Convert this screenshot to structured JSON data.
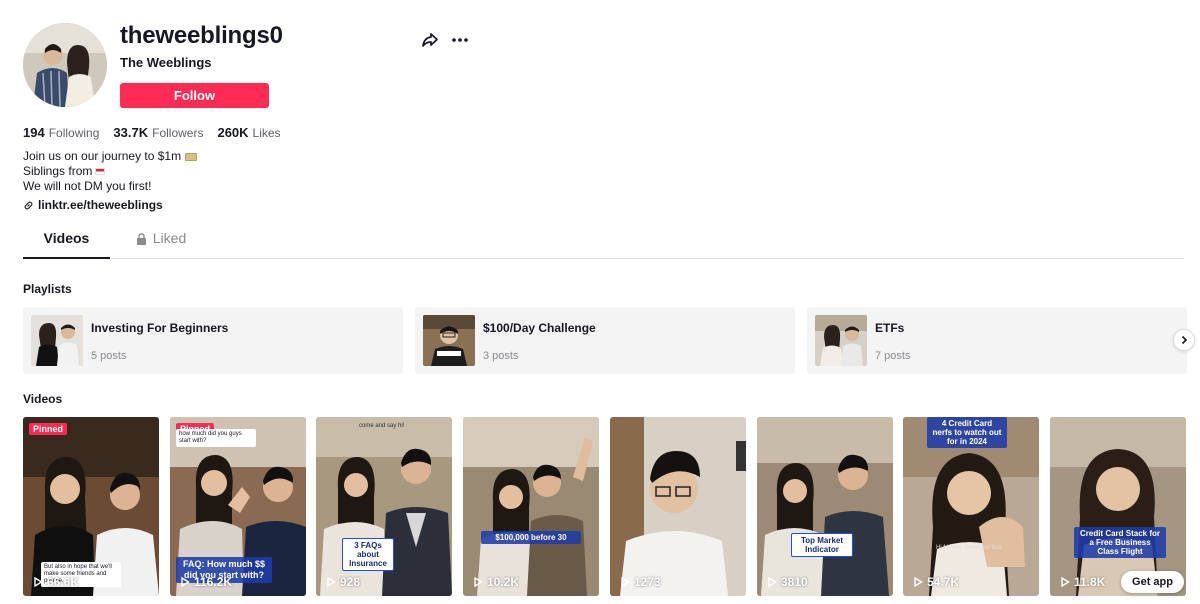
{
  "profile": {
    "username": "theweeblings0",
    "nickname": "The Weeblings",
    "follow_label": "Follow",
    "stats": {
      "following_count": "194",
      "following_label": "Following",
      "followers_count": "33.7K",
      "followers_label": "Followers",
      "likes_count": "260K",
      "likes_label": "Likes"
    },
    "bio": [
      "Join us on our journey to $1m",
      "Siblings from",
      "We will not DM you first!"
    ],
    "link": "linktr.ee/theweeblings"
  },
  "tabs": {
    "videos": "Videos",
    "liked": "Liked"
  },
  "sections": {
    "playlists": "Playlists",
    "videos": "Videos"
  },
  "playlists": [
    {
      "title": "Investing For Beginners",
      "count": "5 posts"
    },
    {
      "title": "$100/Day Challenge",
      "count": "3 posts"
    },
    {
      "title": "ETFs",
      "count": "7 posts"
    }
  ],
  "videos": [
    {
      "views": "66.6K",
      "pinned": "Pinned",
      "caption": "But also in hope that we'll make some friends and people."
    },
    {
      "views": "116.2K",
      "pinned": "Pinned",
      "caption": "FAQ: How much $$ did you start with?",
      "top_caption": "how much did you guys start with?"
    },
    {
      "views": "928",
      "caption": "3 FAQs about Insurance",
      "top_caption": "come and say hi!"
    },
    {
      "views": "10.2K",
      "caption": "$100,000 before 30"
    },
    {
      "views": "1273"
    },
    {
      "views": "3810",
      "caption": "Top Market Indicator"
    },
    {
      "views": "54.7K",
      "caption": "4 Credit Card nerfs to watch out for in 2024",
      "sub_caption": "Hi friends, these are four"
    },
    {
      "views": "11.8K",
      "caption": "Credit Card Stack for a Free Business Class Flight"
    }
  ],
  "get_app": "Get app",
  "icons": {
    "share": "share-icon",
    "more": "more-options-icon",
    "link": "link-icon",
    "lock": "lock-icon",
    "play": "play-icon",
    "next": "chevron-right-icon"
  },
  "colors": {
    "accent": "#fe2c55",
    "text": "#161823",
    "muted": "#8a8b91"
  }
}
